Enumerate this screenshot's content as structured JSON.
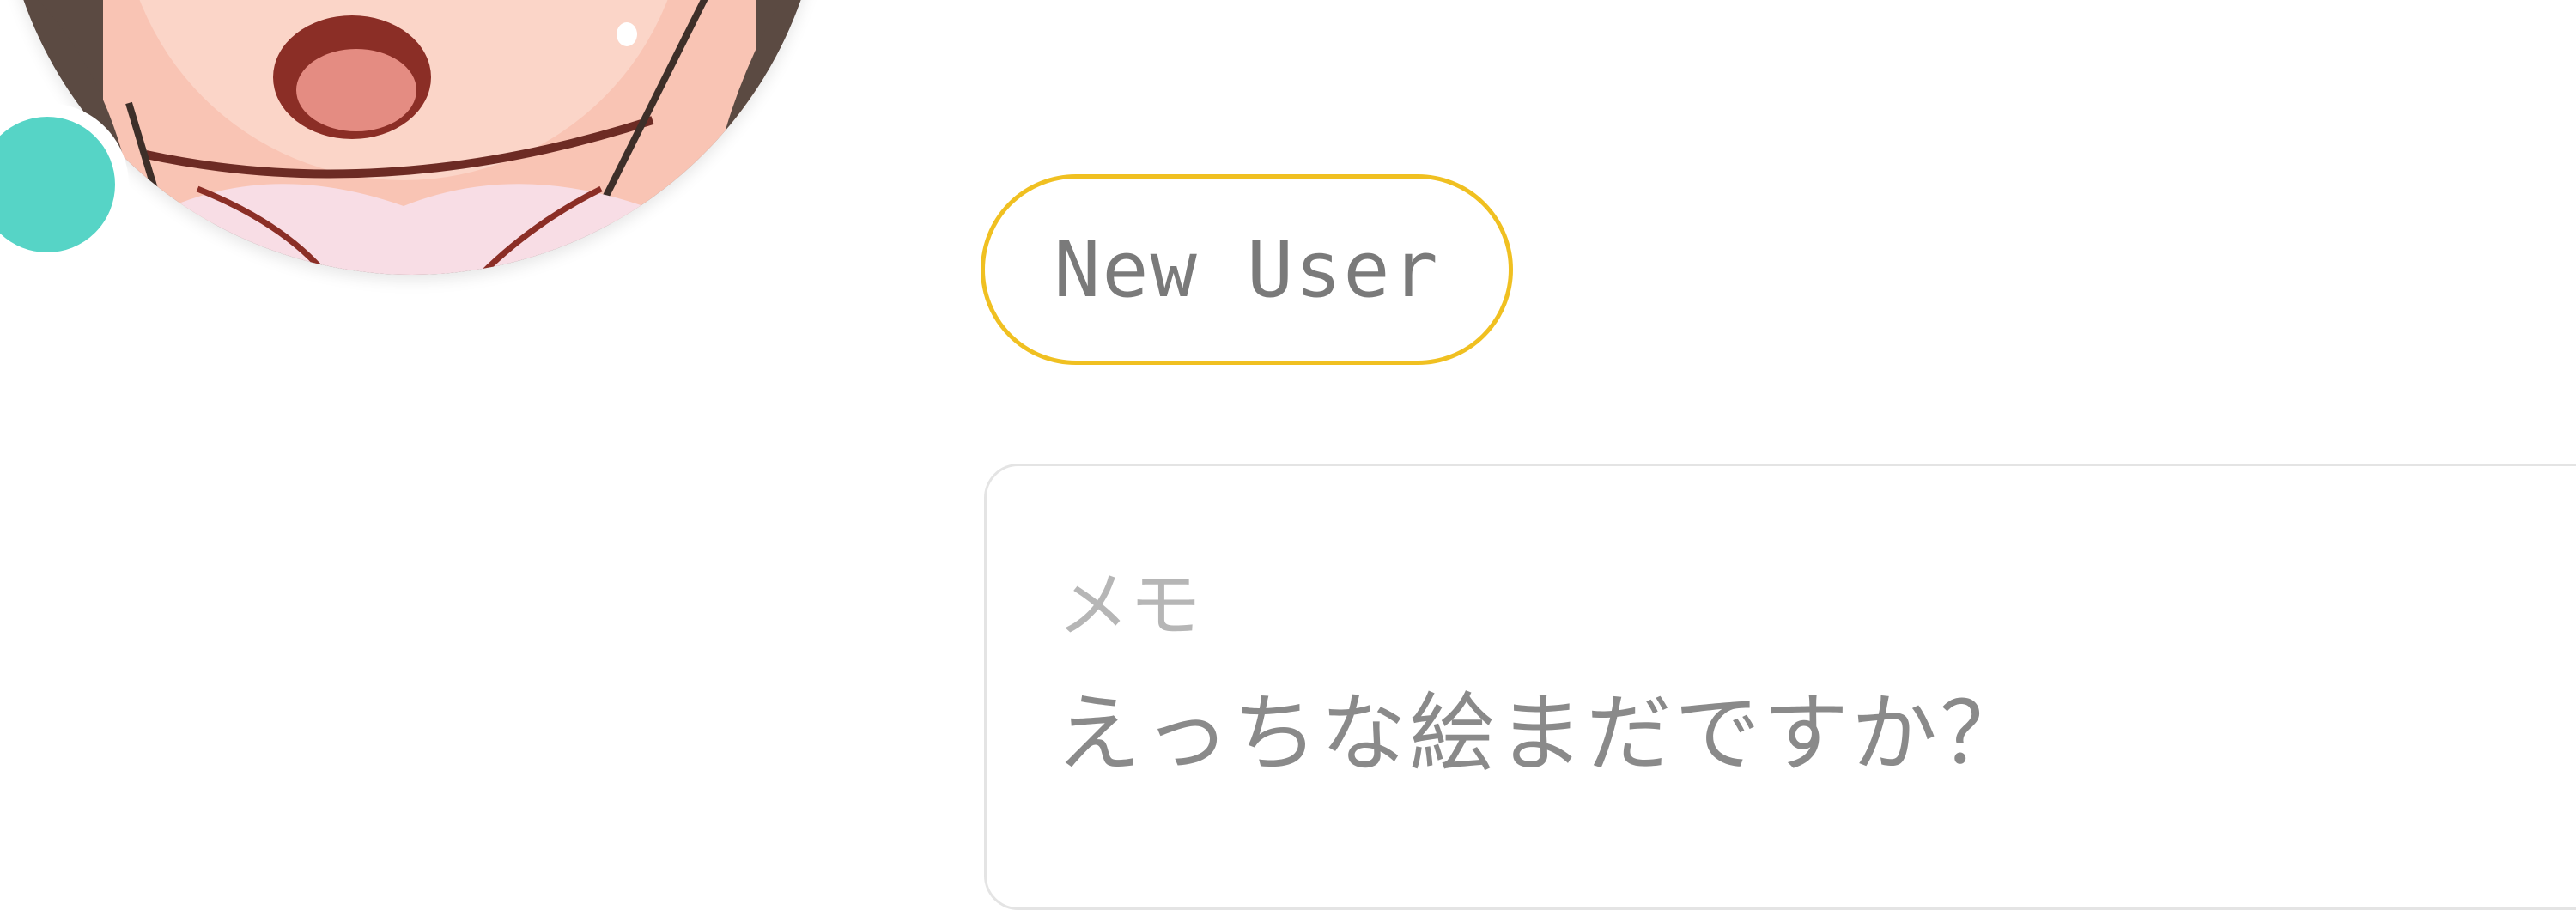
{
  "profile": {
    "status_color": "#56d4c6",
    "badge": {
      "label": "New User",
      "border_color": "#f0c021"
    },
    "memo": {
      "label": "メモ",
      "text": "えっちな絵まだですか？"
    }
  }
}
